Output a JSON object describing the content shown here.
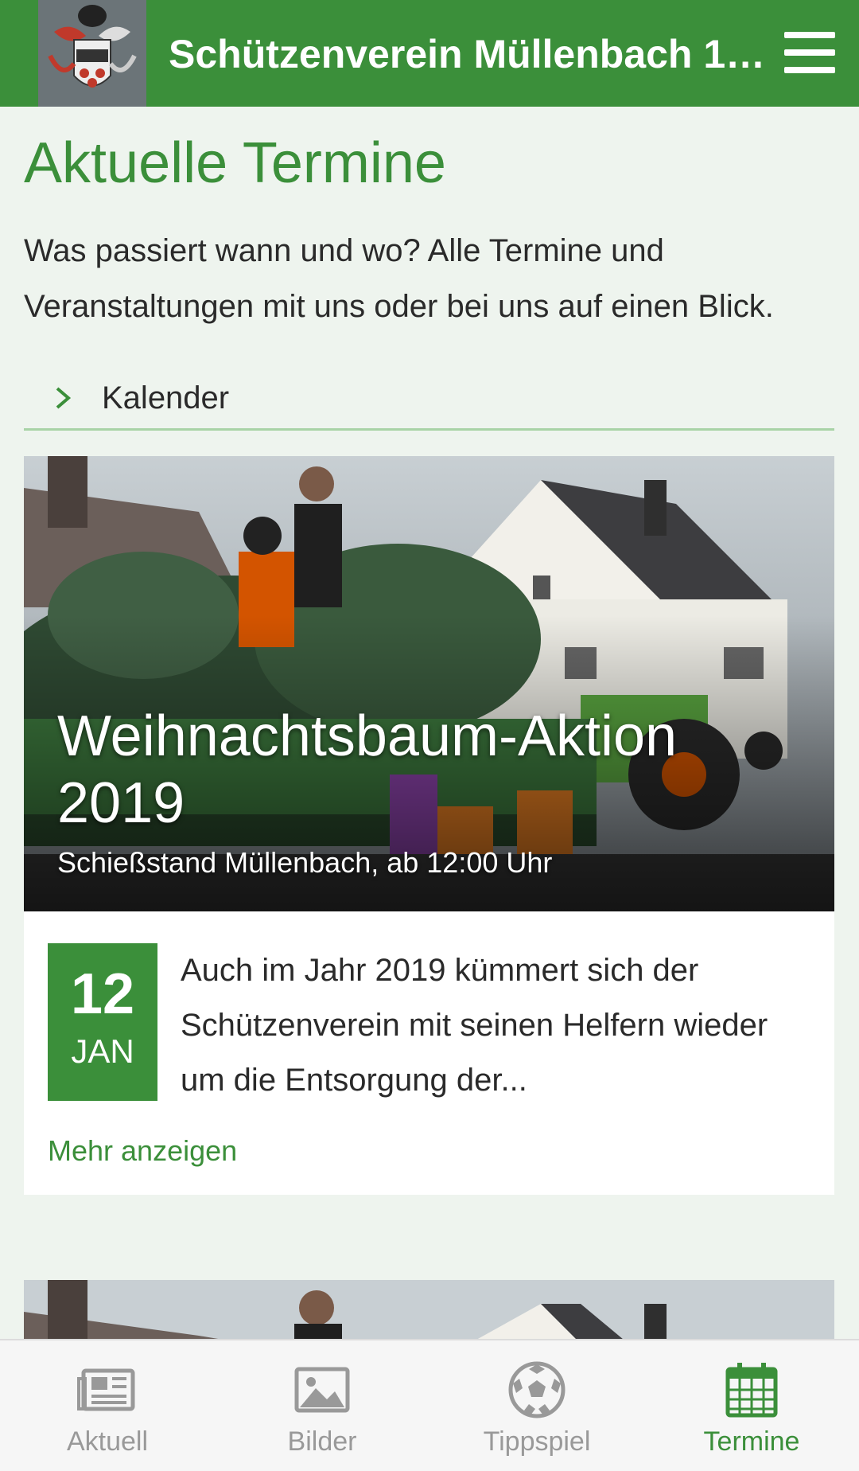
{
  "header": {
    "title": "Schützenverein Müllenbach 15...",
    "logo_icon": "coat-of-arms-logo",
    "menu_icon": "hamburger-menu-icon",
    "color": "#3b8f3a"
  },
  "main": {
    "title": "Aktuelle Termine",
    "intro": "Was passiert wann und wo? Alle Termine und Veranstaltungen mit uns oder bei uns auf einen Blick.",
    "kalender_label": "Kalender"
  },
  "events": [
    {
      "title": "Weihnachtsbaum-Aktion 2019",
      "subtitle": "Schießstand Müllenbach, ab 12:00 Uhr",
      "day": "12",
      "month": "JAN",
      "teaser": "Auch im Jahr 2019 kümmert sich der Schützenverein mit seinen Helfern wieder um die Entsorgung der...",
      "more": "Mehr anzeigen"
    }
  ],
  "bottom_nav": [
    {
      "label": "Aktuell",
      "icon": "newspaper-icon",
      "active": false
    },
    {
      "label": "Bilder",
      "icon": "image-icon",
      "active": false
    },
    {
      "label": "Tippspiel",
      "icon": "soccer-ball-icon",
      "active": false
    },
    {
      "label": "Termine",
      "icon": "calendar-icon",
      "active": true
    }
  ],
  "colors": {
    "accent": "#3b8f3a",
    "background": "#eef4ee",
    "inactive_nav": "#999999"
  }
}
